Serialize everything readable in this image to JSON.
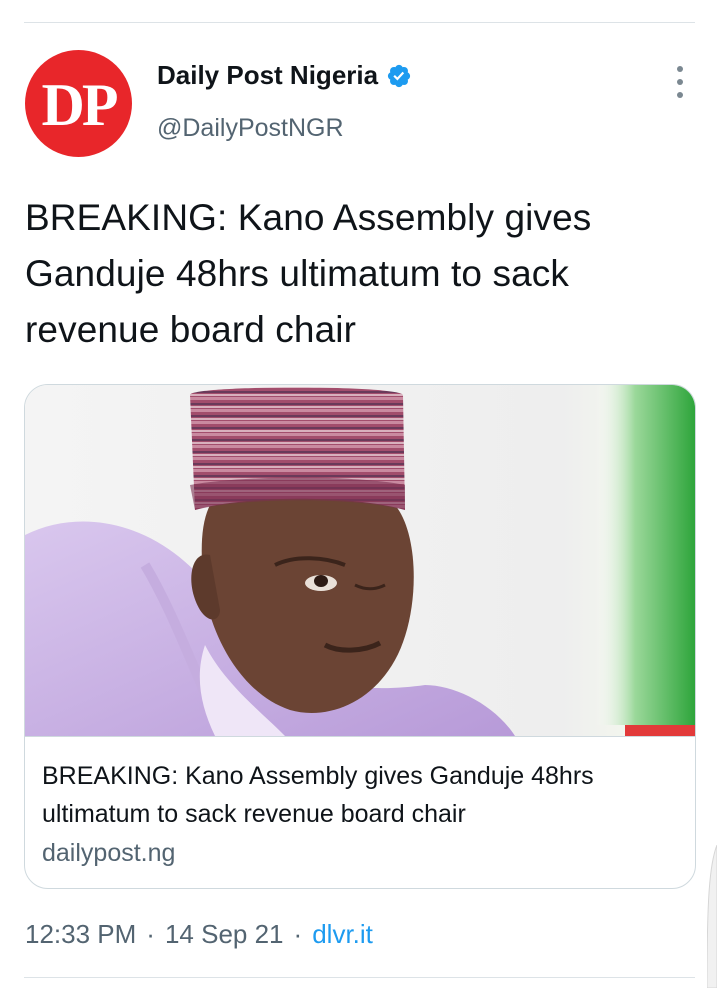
{
  "account": {
    "avatar_text": "DP",
    "name": "Daily Post Nigeria",
    "handle": "@DailyPostNGR",
    "verified_icon": "verified-badge-icon",
    "brand_color": "#e8262a"
  },
  "tweet": {
    "text": "BREAKING: Kano Assembly gives Ganduje 48hrs ultimatum to sack revenue board chair"
  },
  "card": {
    "title": "BREAKING: Kano Assembly gives Ganduje 48hrs ultimatum to sack revenue board chair",
    "domain": "dailypost.ng"
  },
  "meta": {
    "time": "12:33 PM",
    "separator": "·",
    "date": "14 Sep 21",
    "source": "dlvr.it"
  },
  "colors": {
    "link": "#1d9bf0",
    "muted": "#536471"
  }
}
